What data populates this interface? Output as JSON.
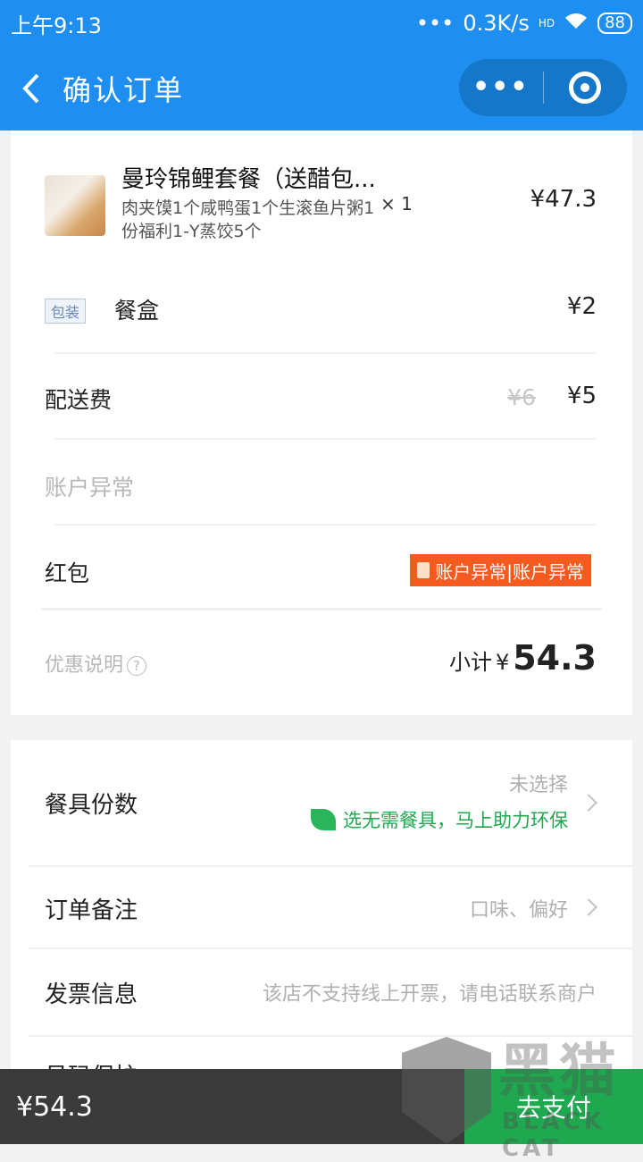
{
  "status_bar": {
    "time": "上午9:13",
    "dots": "•••",
    "speed": "0.3K/s",
    "network": "HD",
    "battery": "88"
  },
  "nav": {
    "title": "确认订单"
  },
  "order": {
    "item": {
      "name": "曼玲锦鲤套餐（送醋包...",
      "desc": "肉夹馍1个咸鸭蛋1个生滚鱼片粥1份福利1-Y蒸饺5个",
      "qty": "× 1",
      "price": "¥47.3"
    },
    "packaging": {
      "tag": "包装",
      "label": "餐盒",
      "price": "¥2"
    },
    "delivery": {
      "label": "配送费",
      "original": "¥6",
      "price": "¥5"
    },
    "account_abnormal": {
      "label": "账户异常"
    },
    "red_packet": {
      "label": "红包",
      "badge": "账户异常|账户异常"
    },
    "discount": {
      "label": "优惠说明",
      "help": "?"
    },
    "subtotal": {
      "label": "小计",
      "currency": "¥",
      "value": "54.3"
    }
  },
  "options": {
    "utensils": {
      "label": "餐具份数",
      "value": "未选择",
      "eco": "选无需餐具，马上助力环保"
    },
    "notes": {
      "label": "订单备注",
      "value": "口味、偏好"
    },
    "invoice": {
      "label": "发票信息",
      "value": "该店不支持线上开票，请电话联系商户"
    },
    "partial_row": {
      "label": "号码保护"
    }
  },
  "footer": {
    "total": "¥54.3",
    "pay_button": "去支付"
  },
  "watermark": {
    "text": "黑猫",
    "sub": "BLACK CAT"
  },
  "colors": {
    "header_blue": "#1e8ff0",
    "eco_green": "#1fa84f",
    "red_packet_orange": "#f55a1e"
  }
}
